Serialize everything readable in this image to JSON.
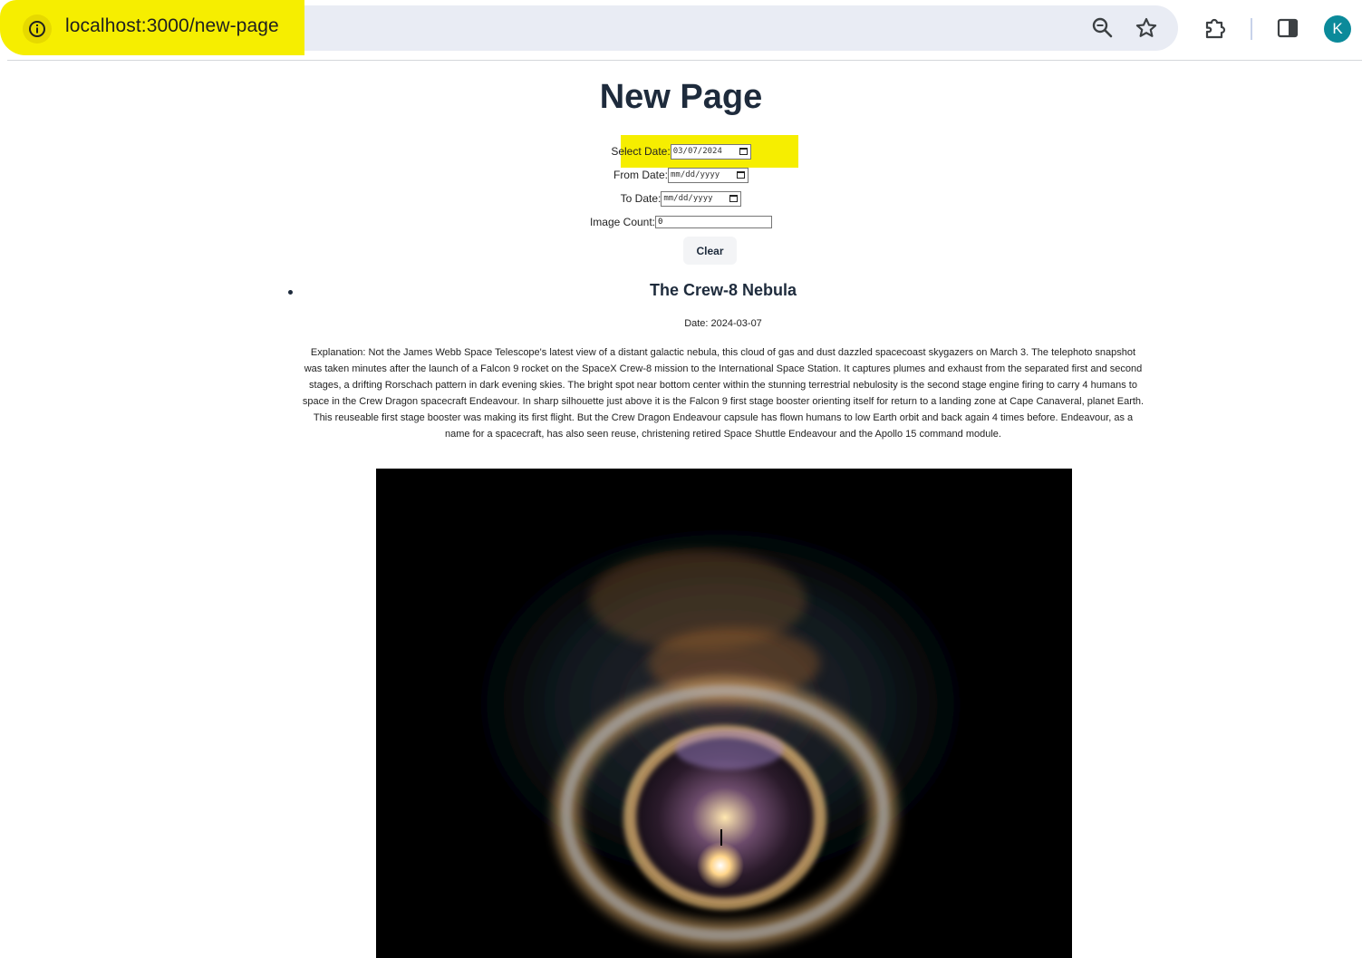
{
  "browser": {
    "url": "localhost:3000/new-page",
    "profile_initial": "K",
    "icons": [
      "info-icon",
      "zoom-icon",
      "star-icon",
      "extensions-icon",
      "side-panel-icon"
    ],
    "highlight_color": "#f6ee00"
  },
  "page": {
    "title": "New Page"
  },
  "form": {
    "select_date_label": "Select Date:",
    "select_date_value": "03/07/2024",
    "from_date_label": "From Date:",
    "from_date_placeholder": "mm/dd/yyyy",
    "to_date_label": "To Date:",
    "to_date_placeholder": "mm/dd/yyyy",
    "image_count_label": "Image Count:",
    "image_count_value": "0",
    "clear_label": "Clear"
  },
  "item": {
    "title": "The Crew-8 Nebula",
    "date": "Date: 2024-03-07",
    "explanation": "Explanation: Not the James Webb Space Telescope's latest view of a distant galactic nebula, this cloud of gas and dust dazzled spacecoast skygazers on March 3. The telephoto snapshot was taken minutes after the launch of a Falcon 9 rocket on the SpaceX Crew-8 mission to the International Space Station. It captures plumes and exhaust from the separated first and second stages, a drifting Rorschach pattern in dark evening skies. The bright spot near bottom center within the stunning terrestrial nebulosity is the second stage engine firing to carry 4 humans to space in the Crew Dragon spacecraft Endeavour. In sharp silhouette just above it is the Falcon 9 first stage booster orienting itself for return to a landing zone at Cape Canaveral, planet Earth. This reuseable first stage booster was making its first flight. But the Crew Dragon Endeavour capsule has flown humans to low Earth orbit and back again 4 times before. Endeavour, as a name for a spacecraft, has also seen reuse, christening retired Space Shuttle Endeavour and the Apollo 15 command module."
  }
}
